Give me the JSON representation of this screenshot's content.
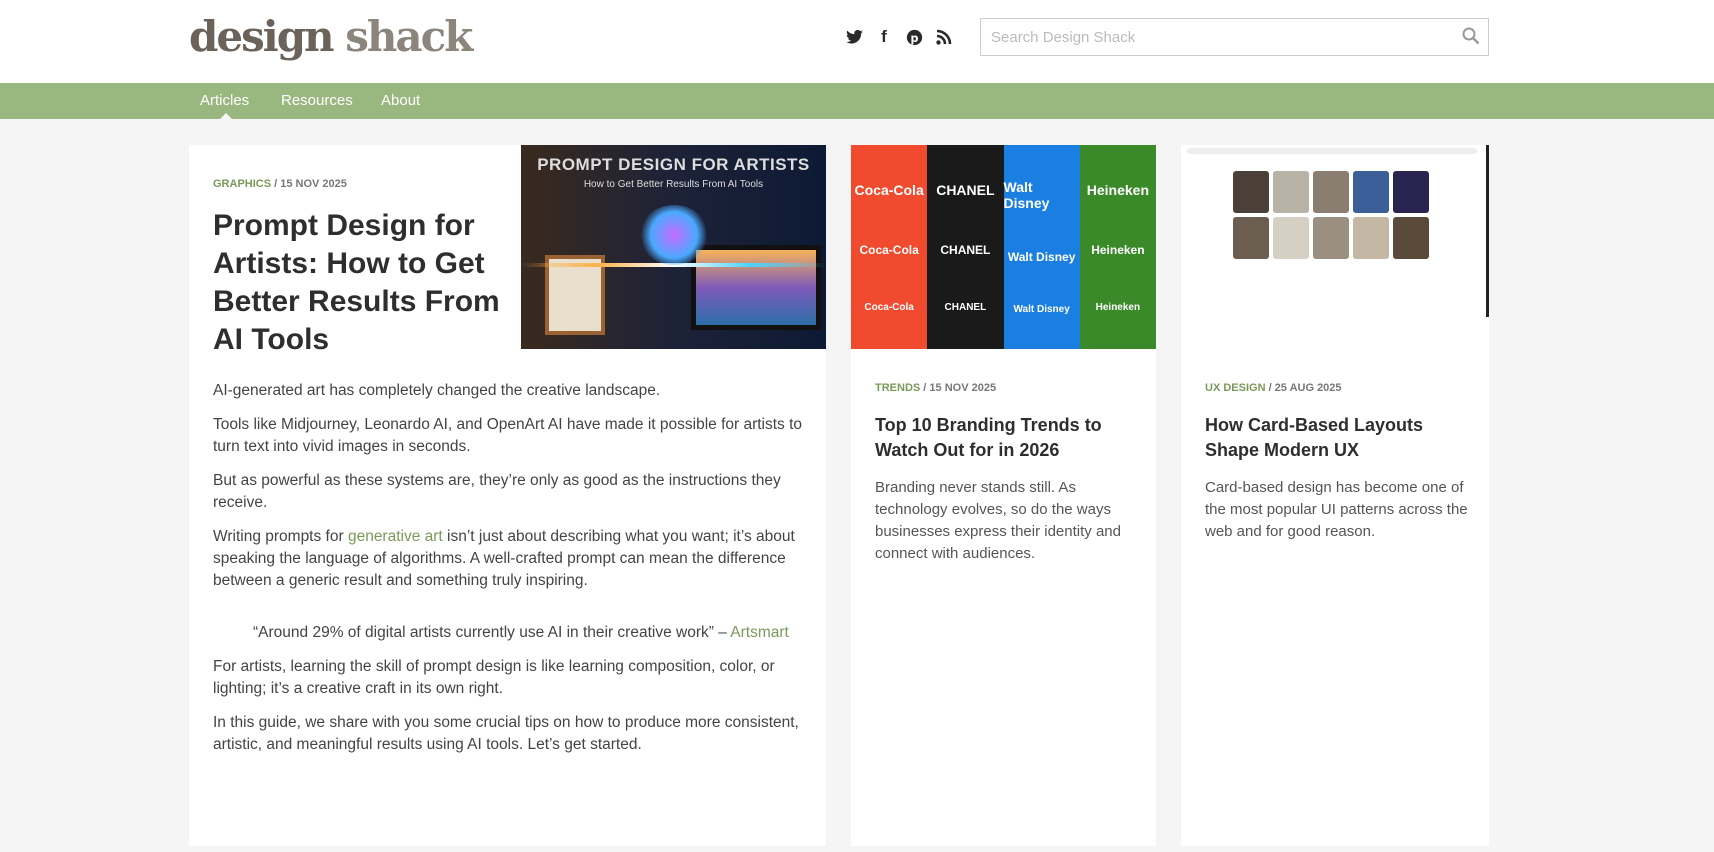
{
  "header": {
    "logo_part1": "design",
    "logo_part2": "shack",
    "social": [
      "twitter-icon",
      "facebook-icon",
      "pinterest-icon",
      "rss-icon"
    ],
    "search_placeholder": "Search Design Shack"
  },
  "nav": {
    "items": [
      {
        "label": "Articles",
        "active": true
      },
      {
        "label": "Resources"
      },
      {
        "label": "About"
      }
    ],
    "color": "#99b880"
  },
  "featured": {
    "category": "Graphics",
    "date": " / 15 Nov 2025",
    "title": "Prompt Design for Artists: How to Get Better Results From AI Tools",
    "image_title": "PROMPT DESIGN FOR ARTISTS",
    "image_subtitle": "How to Get Better Results From AI Tools",
    "p1": "AI-generated art has completely changed the creative landscape.",
    "p2": "Tools like Midjourney, Leonardo AI, and OpenArt AI have made it possible for artists to turn text into vivid images in seconds.",
    "p3": "But as powerful as these systems are, they’re only as good as the instructions they receive.",
    "p4_pre": "Writing prompts for ",
    "p4_link": "generative art",
    "p4_post": " isn’t just about describing what you want; it’s about speaking the language of algorithms. A well-crafted prompt can mean the difference between a generic result and something truly inspiring.",
    "quote": "“Around 29% of digital artists currently use AI in their creative work” – ",
    "quote_source": "Artsmart",
    "p5": "For artists, learning the skill of prompt design is like learning composition, color, or lighting; it’s a creative craft in its own right.",
    "p6": "In this guide, we share with you some crucial tips on how to produce more consistent, artistic, and meaningful results using AI tools. Let’s get started."
  },
  "cards": [
    {
      "category": "Trends",
      "date": " / 15 Nov 2025",
      "title": "Top 10 Branding Trends to Watch Out for in 2026",
      "excerpt": "Branding never stands still. As technology evolves, so do the ways businesses express their identity and connect with audiences.",
      "brands": [
        {
          "name": "Coca-Cola",
          "color": "#f04a2f"
        },
        {
          "name": "CHANEL",
          "color": "#1a1a1a"
        },
        {
          "name": "Walt Disney",
          "color": "#1a7fe0"
        },
        {
          "name": "Heineken",
          "color": "#3a8a2a"
        }
      ]
    },
    {
      "category": "UX Design",
      "date": " / 25 Aug 2025",
      "title": "How Card-Based Layouts Shape Modern UX",
      "excerpt": "Card-based design has become one of the most popular UI patterns across the web and for good reason."
    }
  ]
}
